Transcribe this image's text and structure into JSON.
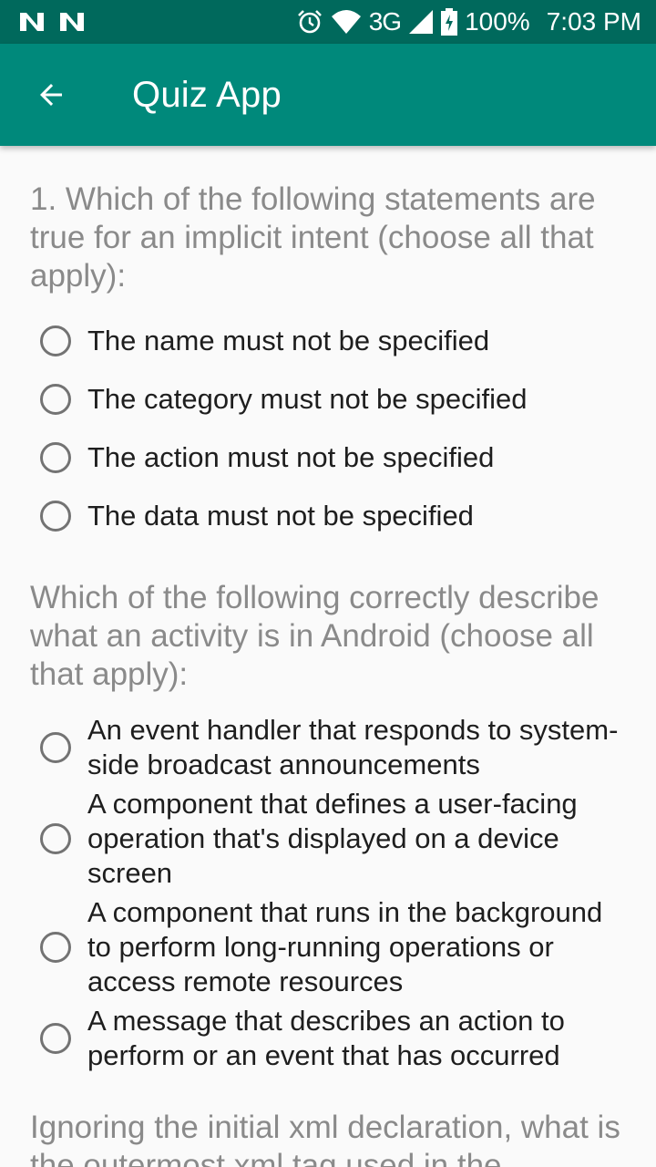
{
  "status_bar": {
    "network": "3G",
    "battery": "100%",
    "time": "7:03 PM",
    "icons": [
      "n-notification-icon",
      "n-notification-icon",
      "alarm-icon",
      "wifi-icon",
      "signal-icon",
      "battery-charging-icon"
    ]
  },
  "app_bar": {
    "title": "Quiz App",
    "back_icon": "arrow-back-icon"
  },
  "colors": {
    "status_bar": "#00695c",
    "app_bar": "#00897b",
    "question_text": "#8a8a8a",
    "option_text": "#1e1e1e",
    "radio_border": "#737373"
  },
  "questions": [
    {
      "text": "1. Which of the following statements are true for an implicit intent (choose all that apply):",
      "options": [
        "The name must not be specified",
        "The category must not be specified",
        "The action must not be specified",
        "The data must not be specified"
      ]
    },
    {
      "text": "Which of the following correctly describe what an activity is in Android (choose all that apply):",
      "options": [
        "An event handler that responds to system-side broadcast announcements",
        "A component that defines a user-facing operation that's displayed on a device screen",
        "A component that runs in the background to perform long-running operations or access remote resources",
        "A message that describes an action to perform or an event that has occurred"
      ]
    },
    {
      "text": "Ignoring the initial xml declaration, what is the outermost xml tag used in the",
      "options": []
    }
  ]
}
